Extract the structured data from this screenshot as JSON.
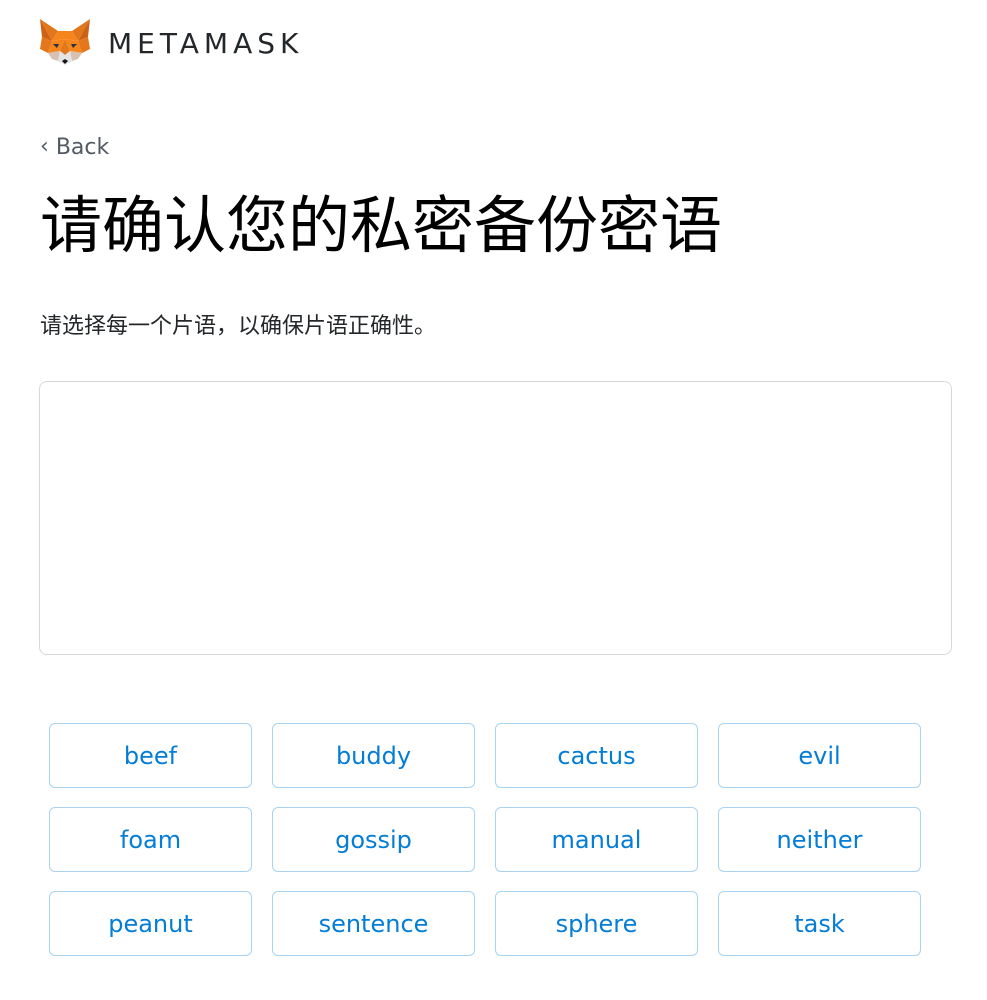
{
  "header": {
    "logo_icon": "metamask-fox-icon",
    "wordmark": "METAMASK"
  },
  "nav": {
    "back_label": "Back",
    "back_icon": "chevron-left-icon"
  },
  "page": {
    "title": "请确认您的私密备份密语",
    "subtitle": "请选择每一个片语，以确保片语正确性。"
  },
  "selected_words": [],
  "words": [
    "beef",
    "buddy",
    "cactus",
    "evil",
    "foam",
    "gossip",
    "manual",
    "neither",
    "peanut",
    "sentence",
    "sphere",
    "task"
  ],
  "colors": {
    "accent": "#037dd6",
    "button_border": "#a8d3f3",
    "dropzone_border": "#d6d9dc",
    "fox_orange": "#e2761b",
    "fox_dark_orange": "#cd6116",
    "fox_beige": "#e4761b"
  }
}
